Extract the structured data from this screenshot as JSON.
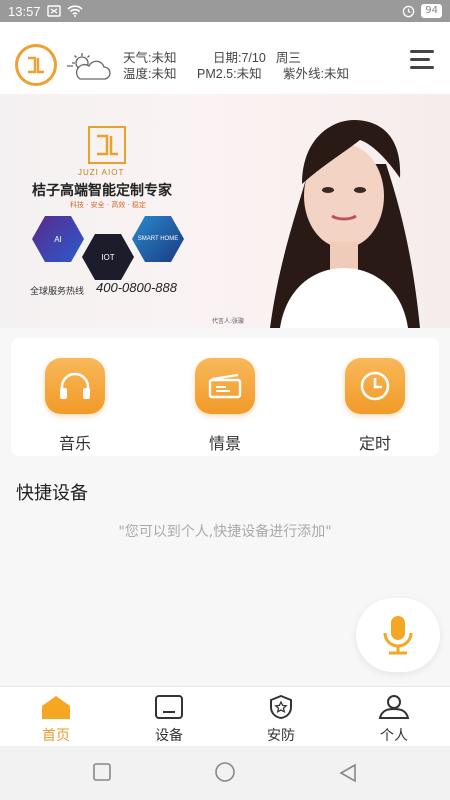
{
  "status_bar": {
    "time": "13:57",
    "battery": "94"
  },
  "header": {
    "weather": {
      "weather_label": "天气:",
      "weather_value": "未知",
      "date_label": "日期:",
      "date_value": "7/10",
      "weekday": "周三",
      "temperature_label": "温度:",
      "temperature_value": "未知",
      "pm25_label": "PM2.5:",
      "pm25_value": "未知",
      "uv_label": "紫外线:",
      "uv_value": "未知"
    },
    "icons": {
      "logo": "brand-logo",
      "weather": "sun-cloud-icon",
      "menu": "hamburger-menu-icon"
    }
  },
  "banner": {
    "brand": "JUZI AIOT",
    "title": "桔子高端智能定制专家",
    "subtitle": "科技 · 安全 · 高效 · 稳定",
    "hex_labels": [
      "AI",
      "IOT",
      "SMART HOME"
    ],
    "hotline_label": "全球服务热线",
    "hotline_number": "400-0800-888",
    "spokesperson": "代言人:张璇"
  },
  "quick_actions": [
    {
      "label": "音乐",
      "icon": "headphones-icon"
    },
    {
      "label": "情景",
      "icon": "scene-card-icon"
    },
    {
      "label": "定时",
      "icon": "clock-icon"
    }
  ],
  "quick_devices": {
    "title": "快捷设备",
    "hint": "\"您可以到个人,快捷设备进行添加\""
  },
  "tabs": [
    {
      "label": "首页",
      "icon": "home-icon",
      "active": true
    },
    {
      "label": "设备",
      "icon": "device-icon",
      "active": false
    },
    {
      "label": "安防",
      "icon": "shield-star-icon",
      "active": false
    },
    {
      "label": "个人",
      "icon": "person-icon",
      "active": false
    }
  ],
  "colors": {
    "accent": "#f29a28",
    "status_bar": "#9a9a9a"
  }
}
